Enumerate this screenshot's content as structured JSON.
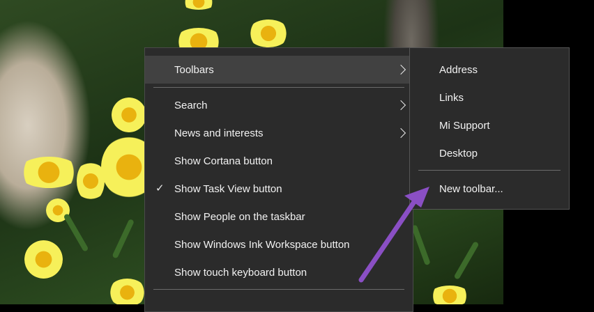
{
  "context_menu": {
    "items": [
      {
        "label": "Toolbars",
        "has_submenu": true,
        "highlighted": true,
        "checked": false
      },
      {
        "label": "Search",
        "has_submenu": true,
        "highlighted": false,
        "checked": false
      },
      {
        "label": "News and interests",
        "has_submenu": true,
        "highlighted": false,
        "checked": false
      },
      {
        "label": "Show Cortana button",
        "has_submenu": false,
        "highlighted": false,
        "checked": false
      },
      {
        "label": "Show Task View button",
        "has_submenu": false,
        "highlighted": false,
        "checked": true
      },
      {
        "label": "Show People on the taskbar",
        "has_submenu": false,
        "highlighted": false,
        "checked": false
      },
      {
        "label": "Show Windows Ink Workspace button",
        "has_submenu": false,
        "highlighted": false,
        "checked": false
      },
      {
        "label": "Show touch keyboard button",
        "has_submenu": false,
        "highlighted": false,
        "checked": false
      }
    ]
  },
  "toolbars_submenu": {
    "items": [
      {
        "label": "Address"
      },
      {
        "label": "Links"
      },
      {
        "label": "Mi Support"
      },
      {
        "label": "Desktop"
      },
      {
        "label": "New toolbar..."
      }
    ]
  },
  "colors": {
    "menu_bg": "#2b2b2b",
    "menu_highlight": "#414141",
    "menu_text": "#f2f2f2",
    "annotation_arrow": "#8a4fc4"
  },
  "icons": {
    "submenu_indicator": "chevron-right-icon",
    "checked_indicator": "checkmark-icon"
  }
}
